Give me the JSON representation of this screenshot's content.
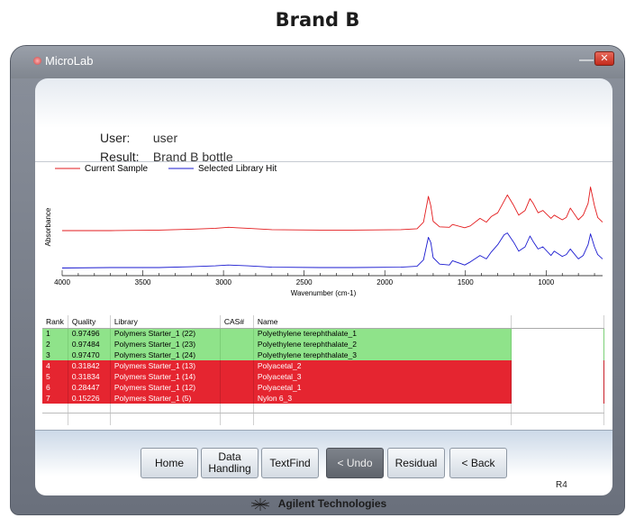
{
  "page_title": "Brand B",
  "window": {
    "app_name": "MicroLab",
    "minimize_glyph": "—",
    "close_glyph": "✕"
  },
  "header": {
    "user_label": "User:",
    "user_value": "user",
    "result_label": "Result:",
    "result_value": "Brand B bottle"
  },
  "legend": {
    "current_sample": "Current Sample",
    "selected_hit": "Selected Library Hit"
  },
  "chart_data": {
    "type": "line",
    "xlabel": "Wavenumber (cm-1)",
    "ylabel": "Absorbance",
    "xlim": [
      4000,
      650
    ],
    "x_ticks": [
      4000,
      3500,
      3000,
      2500,
      2000,
      1500,
      1000
    ],
    "series": [
      {
        "name": "Current Sample",
        "color": "#e31a1c",
        "x": [
          4000,
          3700,
          3400,
          3200,
          3050,
          2970,
          2920,
          2850,
          2700,
          2400,
          2200,
          1900,
          1800,
          1760,
          1730,
          1715,
          1700,
          1660,
          1600,
          1580,
          1505,
          1470,
          1410,
          1370,
          1340,
          1300,
          1260,
          1240,
          1200,
          1170,
          1130,
          1100,
          1080,
          1050,
          1020,
          970,
          950,
          900,
          875,
          850,
          800,
          770,
          740,
          725,
          700,
          680,
          650
        ],
        "y": [
          0.02,
          0.02,
          0.03,
          0.05,
          0.07,
          0.09,
          0.08,
          0.07,
          0.04,
          0.03,
          0.03,
          0.04,
          0.06,
          0.2,
          0.75,
          0.55,
          0.22,
          0.1,
          0.09,
          0.15,
          0.08,
          0.12,
          0.28,
          0.2,
          0.32,
          0.4,
          0.65,
          0.78,
          0.55,
          0.35,
          0.45,
          0.7,
          0.6,
          0.4,
          0.45,
          0.28,
          0.35,
          0.25,
          0.3,
          0.5,
          0.25,
          0.35,
          0.6,
          0.95,
          0.55,
          0.3,
          0.2
        ]
      },
      {
        "name": "Selected Library Hit",
        "color": "#1a1ad0",
        "x": [
          4000,
          3700,
          3400,
          3200,
          3050,
          2970,
          2920,
          2850,
          2700,
          2400,
          2200,
          1900,
          1800,
          1760,
          1730,
          1715,
          1700,
          1660,
          1600,
          1580,
          1505,
          1470,
          1410,
          1370,
          1340,
          1300,
          1260,
          1240,
          1200,
          1170,
          1130,
          1100,
          1080,
          1050,
          1020,
          970,
          950,
          900,
          875,
          850,
          800,
          770,
          740,
          725,
          700,
          680,
          650
        ],
        "y": [
          0.01,
          0.02,
          0.02,
          0.04,
          0.06,
          0.08,
          0.07,
          0.06,
          0.03,
          0.02,
          0.02,
          0.03,
          0.05,
          0.2,
          0.72,
          0.6,
          0.25,
          0.1,
          0.08,
          0.18,
          0.08,
          0.15,
          0.3,
          0.22,
          0.38,
          0.55,
          0.78,
          0.82,
          0.6,
          0.4,
          0.5,
          0.75,
          0.62,
          0.45,
          0.5,
          0.3,
          0.4,
          0.28,
          0.32,
          0.45,
          0.22,
          0.3,
          0.55,
          0.8,
          0.5,
          0.32,
          0.22
        ]
      }
    ]
  },
  "table": {
    "headers": [
      "Rank",
      "Quality",
      "Library",
      "CAS#",
      "Name"
    ],
    "rows": [
      {
        "rank": "1",
        "quality": "0.97496",
        "library": "Polymers Starter_1 (22)",
        "cas": "",
        "name": "Polyethylene terephthalate_1",
        "status": "match"
      },
      {
        "rank": "2",
        "quality": "0.97484",
        "library": "Polymers Starter_1 (23)",
        "cas": "",
        "name": "Polyethylene terephthalate_2",
        "status": "match"
      },
      {
        "rank": "3",
        "quality": "0.97470",
        "library": "Polymers Starter_1 (24)",
        "cas": "",
        "name": "Polyethylene terephthalate_3",
        "status": "match"
      },
      {
        "rank": "4",
        "quality": "0.31842",
        "library": "Polymers Starter_1 (13)",
        "cas": "",
        "name": "Polyacetal_2",
        "status": "nomatch"
      },
      {
        "rank": "5",
        "quality": "0.31834",
        "library": "Polymers Starter_1 (14)",
        "cas": "",
        "name": "Polyacetal_3",
        "status": "nomatch"
      },
      {
        "rank": "6",
        "quality": "0.28447",
        "library": "Polymers Starter_1 (12)",
        "cas": "",
        "name": "Polyacetal_1",
        "status": "nomatch"
      },
      {
        "rank": "7",
        "quality": "0.15226",
        "library": "Polymers Starter_1 (5)",
        "cas": "",
        "name": "Nylon 6_3",
        "status": "nomatch"
      }
    ]
  },
  "buttons": {
    "home": "Home",
    "data_handling_1": "Data",
    "data_handling_2": "Handling",
    "textfind": "TextFind",
    "undo": "< Undo",
    "residual": "Residual",
    "back": "< Back"
  },
  "revision": "R4",
  "brand": "Agilent Technologies",
  "colors": {
    "match_row": "#8fe38a",
    "nomatch_row": "#e52530",
    "current_sample": "#e31a1c",
    "library_hit": "#1a1ad0"
  }
}
